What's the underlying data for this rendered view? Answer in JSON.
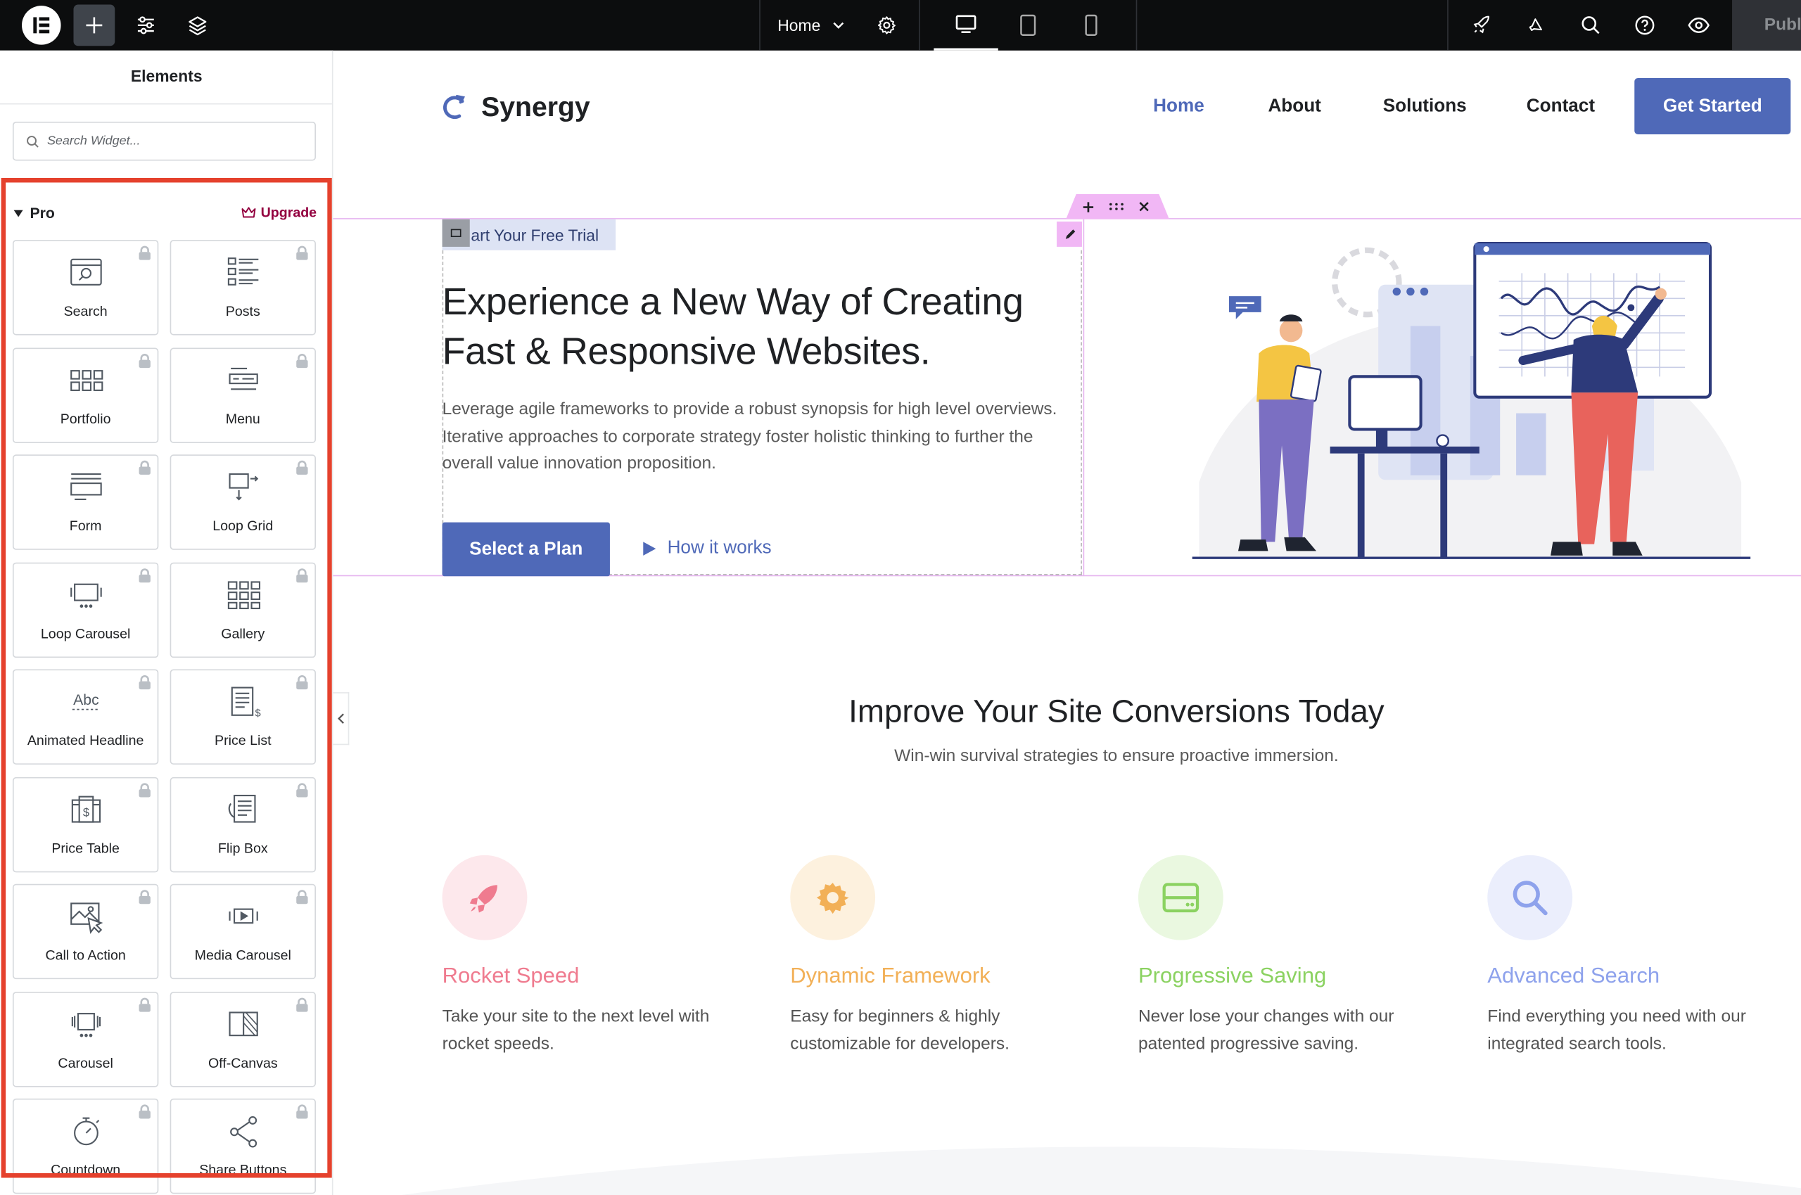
{
  "topbar": {
    "page_name": "Home",
    "publish_label": "Publi"
  },
  "sidebar": {
    "title": "Elements",
    "search_placeholder": "Search Widget...",
    "section_label": "Pro",
    "upgrade_label": "Upgrade",
    "widgets": [
      {
        "label": "Search",
        "icon": "search-widget-icon"
      },
      {
        "label": "Posts",
        "icon": "posts-icon"
      },
      {
        "label": "Portfolio",
        "icon": "portfolio-icon"
      },
      {
        "label": "Menu",
        "icon": "menu-icon"
      },
      {
        "label": "Form",
        "icon": "form-icon"
      },
      {
        "label": "Loop Grid",
        "icon": "loop-grid-icon"
      },
      {
        "label": "Loop Carousel",
        "icon": "loop-carousel-icon"
      },
      {
        "label": "Gallery",
        "icon": "gallery-icon"
      },
      {
        "label": "Animated Headline",
        "icon": "animated-headline-icon"
      },
      {
        "label": "Price List",
        "icon": "price-list-icon"
      },
      {
        "label": "Price Table",
        "icon": "price-table-icon"
      },
      {
        "label": "Flip Box",
        "icon": "flip-box-icon"
      },
      {
        "label": "Call to Action",
        "icon": "call-to-action-icon"
      },
      {
        "label": "Media Carousel",
        "icon": "media-carousel-icon"
      },
      {
        "label": "Carousel",
        "icon": "carousel-icon"
      },
      {
        "label": "Off-Canvas",
        "icon": "off-canvas-icon"
      },
      {
        "label": "Countdown",
        "icon": "countdown-icon"
      },
      {
        "label": "Share Buttons",
        "icon": "share-buttons-icon"
      }
    ],
    "highlight_color": "#e5412d"
  },
  "site": {
    "logo_text": "Synergy",
    "nav": [
      "Home",
      "About",
      "Solutions",
      "Contact"
    ],
    "cta_label": "Get Started",
    "accent": "#4f69b8"
  },
  "hero": {
    "eyebrow": "art Your Free Trial",
    "heading": "Experience a New Way of Creating Fast & Responsive Websites.",
    "paragraph": "Leverage agile frameworks to provide a robust synopsis for high level overviews. Iterative approaches to corporate strategy foster holistic thinking to further the overall value innovation proposition.",
    "primary_button": "Select a Plan",
    "secondary_link": "How it works"
  },
  "section": {
    "title": "Improve Your Site Conversions Today",
    "subtitle": "Win-win survival strategies to ensure proactive immersion."
  },
  "features": [
    {
      "title": "Rocket Speed",
      "desc": "Take your site to the next level with rocket speeds.",
      "color": "#ef7b8f",
      "bg": "#fde8ec",
      "icon": "rocket-icon"
    },
    {
      "title": "Dynamic Framework",
      "desc": "Easy for beginners & highly customizable for developers.",
      "color": "#f2b057",
      "bg": "#fdf1de",
      "icon": "cog-icon"
    },
    {
      "title": "Progressive Saving",
      "desc": "Never lose your changes with our patented progressive saving.",
      "color": "#8bd261",
      "bg": "#eaf8e0",
      "icon": "drive-icon"
    },
    {
      "title": "Advanced Search",
      "desc": "Find everything you need with our integrated search tools.",
      "color": "#8ea2ec",
      "bg": "#ebeefc",
      "icon": "search-icon"
    }
  ]
}
